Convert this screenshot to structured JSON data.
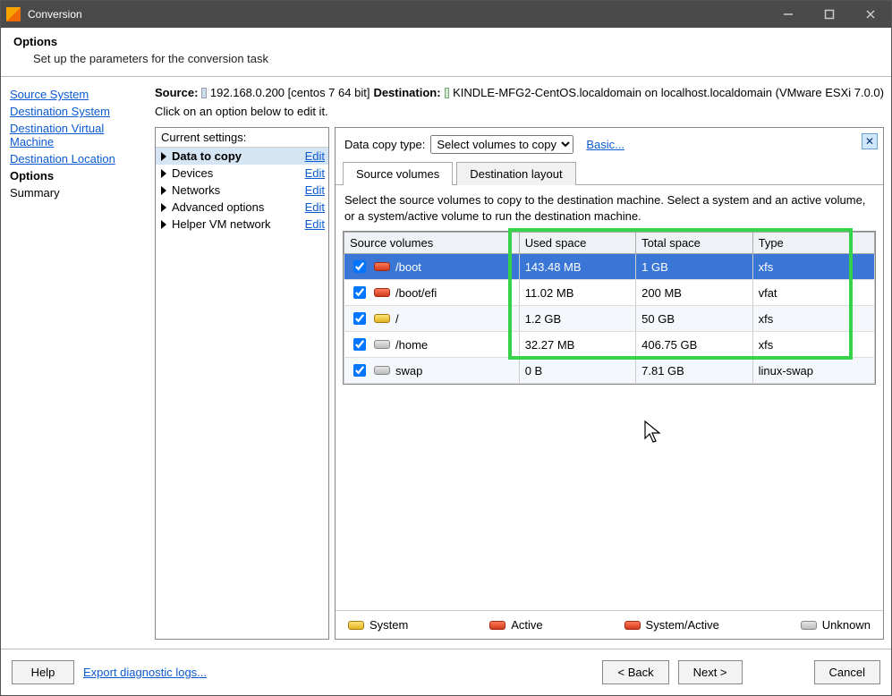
{
  "window": {
    "title": "Conversion"
  },
  "header": {
    "title": "Options",
    "subtitle": "Set up the parameters for the conversion task"
  },
  "nav": {
    "items": [
      {
        "label": "Source System",
        "link": true
      },
      {
        "label": "Destination System",
        "link": true
      },
      {
        "label": "Destination Virtual Machine",
        "link": true
      },
      {
        "label": "Destination Location",
        "link": true
      },
      {
        "label": "Options",
        "link": false
      },
      {
        "label": "Summary",
        "link": false
      }
    ]
  },
  "info": {
    "source_label": "Source:",
    "source_value": "192.168.0.200 [centos 7 64 bit]",
    "dest_label": "Destination:",
    "dest_value": "KINDLE-MFG2-CentOS.localdomain on localhost.localdomain (VMware ESXi 7.0.0)",
    "hint": "Click on an option below to edit it."
  },
  "settings": {
    "header": "Current settings:",
    "rows": [
      {
        "label": "Data to copy",
        "selected": true,
        "action": "Edit"
      },
      {
        "label": "Devices",
        "selected": false,
        "action": "Edit"
      },
      {
        "label": "Networks",
        "selected": false,
        "action": "Edit"
      },
      {
        "label": "Advanced options",
        "selected": false,
        "action": "Edit"
      },
      {
        "label": "Helper VM network",
        "selected": false,
        "action": "Edit"
      }
    ]
  },
  "detail": {
    "copytype_label": "Data copy type:",
    "copytype_value": "Select volumes to copy",
    "basic_link": "Basic...",
    "tabs": [
      "Source volumes",
      "Destination layout"
    ],
    "active_tab": 0,
    "instructions": "Select the source volumes to copy to the destination machine. Select a system and an active volume, or a system/active volume to run the destination machine.",
    "columns": [
      "Source volumes",
      "Used space",
      "Total space",
      "Type"
    ],
    "rows": [
      {
        "checked": true,
        "icon": "red",
        "name": "/boot",
        "used": "143.48 MB",
        "total": "1 GB",
        "type": "xfs",
        "selected": true
      },
      {
        "checked": true,
        "icon": "red",
        "name": "/boot/efi",
        "used": "11.02 MB",
        "total": "200 MB",
        "type": "vfat",
        "selected": false
      },
      {
        "checked": true,
        "icon": "ylw",
        "name": "/",
        "used": "1.2 GB",
        "total": "50 GB",
        "type": "xfs",
        "selected": false
      },
      {
        "checked": true,
        "icon": "grey",
        "name": "/home",
        "used": "32.27 MB",
        "total": "406.75 GB",
        "type": "xfs",
        "selected": false
      },
      {
        "checked": true,
        "icon": "grey",
        "name": "swap",
        "used": "0 B",
        "total": "7.81 GB",
        "type": "linux-swap",
        "selected": false
      }
    ],
    "legend": [
      "System",
      "Active",
      "System/Active",
      "Unknown"
    ]
  },
  "footer": {
    "help": "Help",
    "export": "Export diagnostic logs...",
    "back": "< Back",
    "next": "Next >",
    "cancel": "Cancel"
  }
}
